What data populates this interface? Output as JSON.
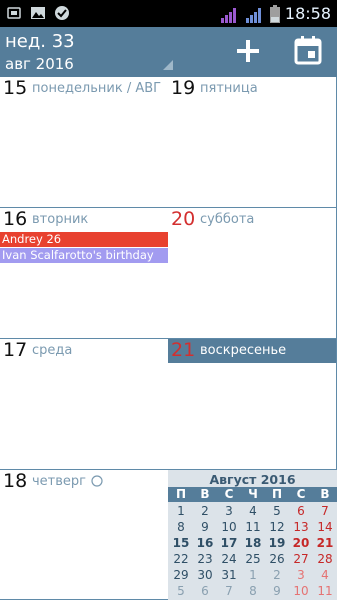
{
  "statusbar": {
    "time": "18:58",
    "icons": [
      "usb-icon",
      "image-icon",
      "check-badge-icon",
      "signal-icon",
      "battery-icon"
    ]
  },
  "appbar": {
    "week": "нед. 33",
    "month": "авг 2016",
    "add_icon": "plus-icon",
    "today_icon": "calendar-icon"
  },
  "days": [
    {
      "num": "15",
      "name": "понедельник / АВГ",
      "red": false
    },
    {
      "num": "16",
      "name": "вторник",
      "red": false
    },
    {
      "num": "17",
      "name": "среда",
      "red": false
    },
    {
      "num": "18",
      "name": "четверг",
      "red": false
    },
    {
      "num": "19",
      "name": "пятница",
      "red": false
    },
    {
      "num": "20",
      "name": "суббота",
      "red": true
    },
    {
      "num": "21",
      "name": "воскресенье",
      "red": true,
      "today": true
    }
  ],
  "events": [
    {
      "label": "Andrey 26",
      "color": "#e8412f"
    },
    {
      "label": "Ivan Scalfarotto's birthday",
      "color": "#a29bf0"
    }
  ],
  "colors": {
    "appbar": "#557d9a",
    "grid_line": "#5f8aa8",
    "weekend": "#d32f2f"
  },
  "mini_calendar": {
    "title": "Август 2016",
    "weekdays": [
      "П",
      "В",
      "С",
      "Ч",
      "П",
      "С",
      "В"
    ],
    "rows": [
      [
        "1",
        "2",
        "3",
        "4",
        "5",
        "6",
        "7"
      ],
      [
        "8",
        "9",
        "10",
        "11",
        "12",
        "13",
        "14"
      ],
      [
        "15",
        "16",
        "17",
        "18",
        "19",
        "20",
        "21"
      ],
      [
        "22",
        "23",
        "24",
        "25",
        "26",
        "27",
        "28"
      ],
      [
        "29",
        "30",
        "31",
        "1",
        "2",
        "3",
        "4"
      ],
      [
        "5",
        "6",
        "7",
        "8",
        "9",
        "10",
        "11"
      ]
    ]
  }
}
